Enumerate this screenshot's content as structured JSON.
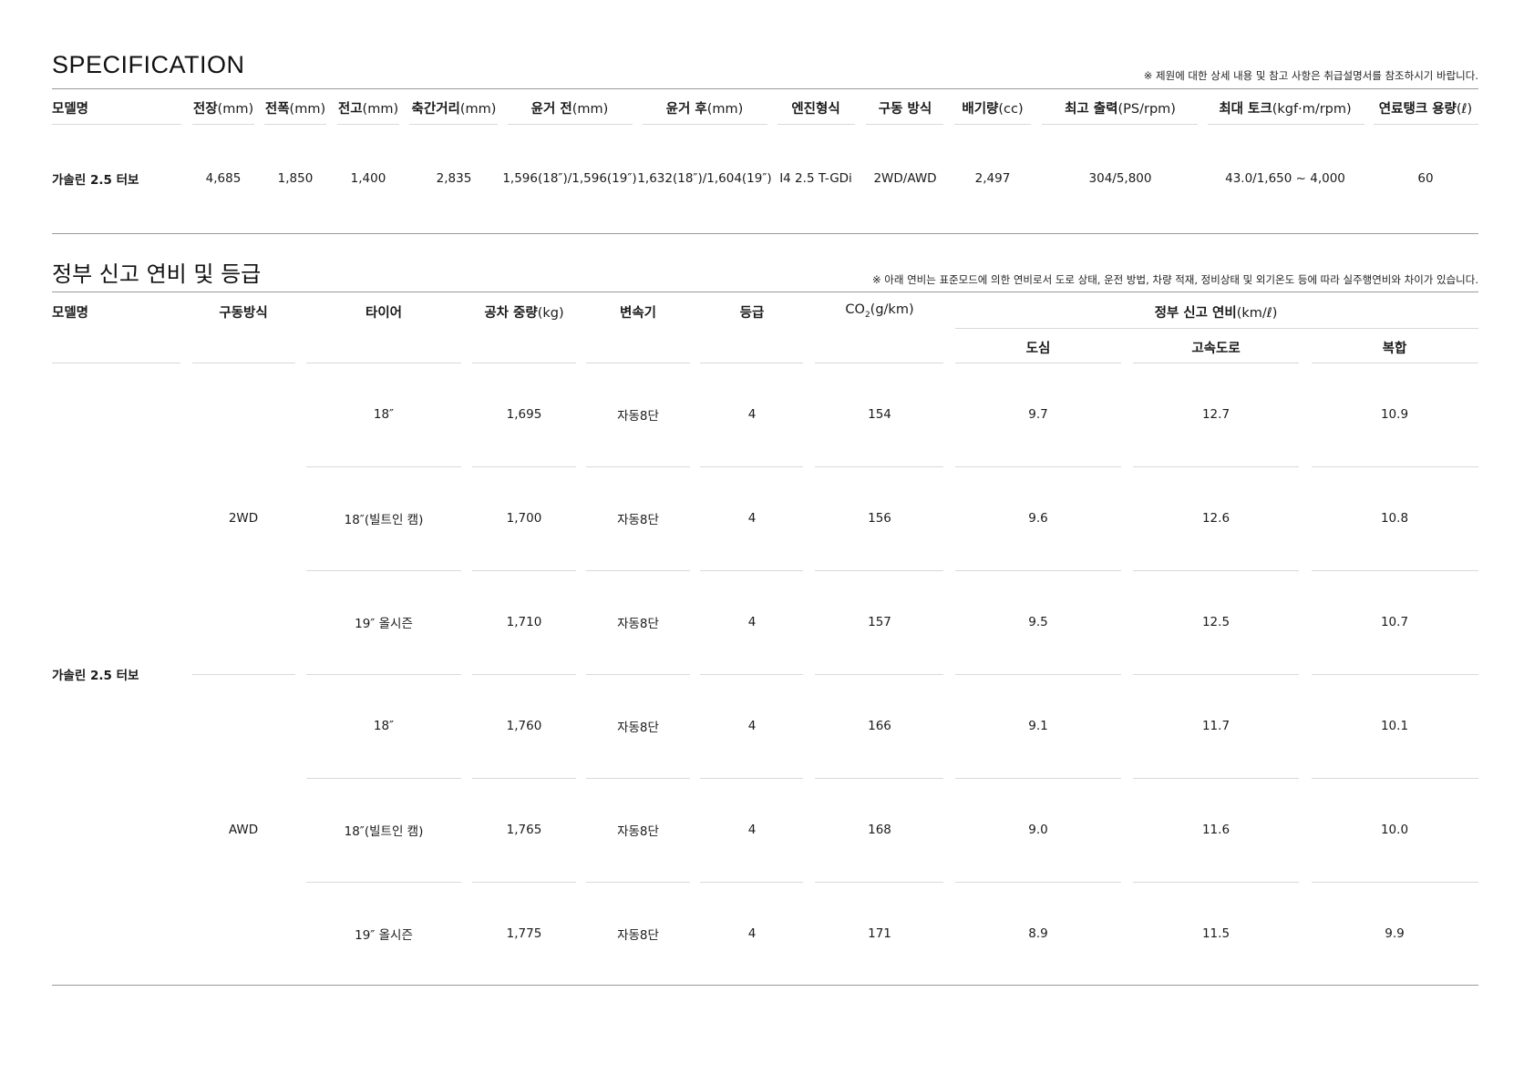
{
  "spec": {
    "title": "SPECIFICATION",
    "note": "※ 제원에 대한 상세 내용 및 참고 사항은 취급설명서를 참조하시기 바랍니다.",
    "headers": [
      {
        "label": "모델명",
        "unit": ""
      },
      {
        "label": "전장",
        "unit": "(mm)"
      },
      {
        "label": "전폭",
        "unit": "(mm)"
      },
      {
        "label": "전고",
        "unit": "(mm)"
      },
      {
        "label": "축간거리",
        "unit": "(mm)"
      },
      {
        "label": "윤거 전",
        "unit": "(mm)"
      },
      {
        "label": "윤거 후",
        "unit": "(mm)"
      },
      {
        "label": "엔진형식",
        "unit": ""
      },
      {
        "label": "구동 방식",
        "unit": ""
      },
      {
        "label": "배기량",
        "unit": "(cc)"
      },
      {
        "label": "최고 출력",
        "unit": "(PS/rpm)"
      },
      {
        "label": "최대 토크",
        "unit": "(kgf·m/rpm)"
      },
      {
        "label": "연료탱크 용량",
        "unit": "(ℓ)"
      }
    ],
    "row": [
      "가솔린 2.5 터보",
      "4,685",
      "1,850",
      "1,400",
      "2,835",
      "1,596(18″)/1,596(19″)",
      "1,632(18″)/1,604(19″)",
      "I4 2.5 T-GDi",
      "2WD/AWD",
      "2,497",
      "304/5,800",
      "43.0/1,650 ~ 4,000",
      "60"
    ]
  },
  "fuel": {
    "title": "정부 신고 연비 및 등급",
    "note": "※ 아래 연비는 표준모드에 의한 연비로서 도로 상태, 운전 방법, 차량 적재, 정비상태 및 외기온도 등에 따라 실주행연비와 차이가 있습니다.",
    "headers": {
      "model": "모델명",
      "drive": "구동방식",
      "tire": "타이어",
      "weight": "공차 중량",
      "weight_unit": "(kg)",
      "transmission": "변속기",
      "grade": "등급",
      "co2_a": "CO",
      "co2_sub": "2",
      "co2_unit": "(g/km)",
      "efficiency": "정부 신고 연비",
      "efficiency_unit": "(km/ℓ)",
      "city": "도심",
      "highway": "고속도로",
      "combined": "복합"
    },
    "model": "가솔린 2.5 터보",
    "groups": [
      {
        "drive": "2WD",
        "rows": [
          [
            "18″",
            "1,695",
            "자동8단",
            "4",
            "154",
            "9.7",
            "12.7",
            "10.9"
          ],
          [
            "18″(빌트인 캠)",
            "1,700",
            "자동8단",
            "4",
            "156",
            "9.6",
            "12.6",
            "10.8"
          ],
          [
            "19″ 올시즌",
            "1,710",
            "자동8단",
            "4",
            "157",
            "9.5",
            "12.5",
            "10.7"
          ]
        ]
      },
      {
        "drive": "AWD",
        "rows": [
          [
            "18″",
            "1,760",
            "자동8단",
            "4",
            "166",
            "9.1",
            "11.7",
            "10.1"
          ],
          [
            "18″(빌트인 캠)",
            "1,765",
            "자동8단",
            "4",
            "168",
            "9.0",
            "11.6",
            "10.0"
          ],
          [
            "19″ 올시즌",
            "1,775",
            "자동8단",
            "4",
            "171",
            "8.9",
            "11.5",
            "9.9"
          ]
        ]
      }
    ]
  }
}
